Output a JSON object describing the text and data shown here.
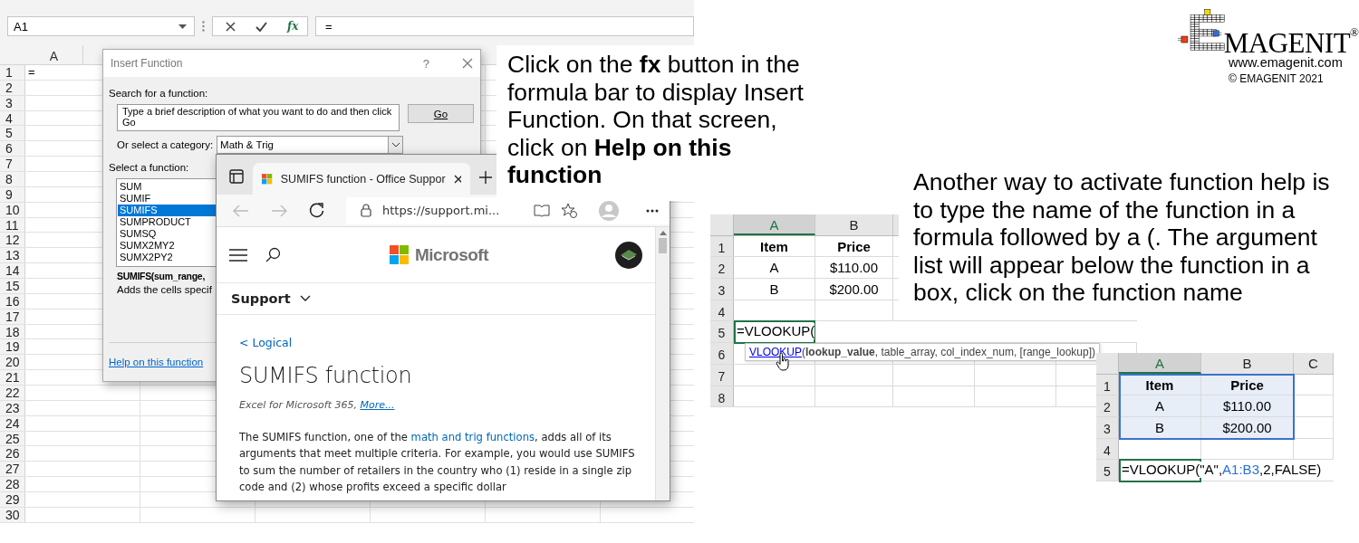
{
  "excel": {
    "name_box": "A1",
    "fx_button": "fx",
    "formula": "=",
    "column_header": "A",
    "row_numbers": [
      "1",
      "2",
      "3",
      "4",
      "5",
      "6",
      "7",
      "8",
      "9",
      "10",
      "11",
      "12",
      "13",
      "14",
      "15",
      "16",
      "17",
      "18",
      "19",
      "20",
      "21",
      "22",
      "23",
      "24",
      "25",
      "26",
      "27",
      "28",
      "29",
      "30"
    ],
    "cell_a1": "="
  },
  "insert_function": {
    "title": "Insert Function",
    "help": "?",
    "search_label": "Search for a function:",
    "search_value": "Type a brief description of what you want to do and then click Go",
    "go_button": "Go",
    "category_label": "Or select a category:",
    "category": "Math & Trig",
    "function_label": "Select a function:",
    "functions": [
      {
        "label": "SUM",
        "selected": false
      },
      {
        "label": "SUMIF",
        "selected": false
      },
      {
        "label": "SUMIFS",
        "selected": true
      },
      {
        "label": "SUMPRODUCT",
        "selected": false
      },
      {
        "label": "SUMSQ",
        "selected": false
      },
      {
        "label": "SUMX2MY2",
        "selected": false
      },
      {
        "label": "SUMX2PY2",
        "selected": false
      }
    ],
    "signature": "SUMIFS(sum_range,",
    "description": "Adds the cells specif",
    "help_link": "Help on this function"
  },
  "browser": {
    "tab_title": "SUMIFS function - Office Suppor",
    "url": "https://support.mi...",
    "brand": "Microsoft",
    "nav": "Support",
    "breadcrumb": "< Logical",
    "heading": "SUMIFS function",
    "applies_to": "Excel for Microsoft 365, ",
    "more_link": "More...",
    "body_start": "The SUMIFS function, one of the ",
    "body_link": "math and trig functions",
    "body_end": ", adds all of its arguments that meet multiple criteria. For example, you would use SUMIFS to sum the number of retailers in the country who (1) reside in a single zip code and (2) whose profits exceed a specific dollar"
  },
  "callout_fx": "Click on the **fx** button in the formula bar to display Insert Function. On that screen, click on **Help on this function**",
  "logo": {
    "name": "MAGENIT",
    "registered": "®",
    "url": "www.emagenit.com",
    "copyright": "© EMAGENIT  2021"
  },
  "callout_typing": "Another way to activate function help is to type the name of the function in a formula followed by a (. The argument list will appear below the function in a box, click on the function name",
  "sheet_typing": {
    "columns": [
      {
        "label": "A",
        "active": true
      },
      {
        "label": "B",
        "active": false
      }
    ],
    "rows": [
      {
        "number": "1",
        "kind": "header",
        "cells": [
          "Item",
          "Price"
        ]
      },
      {
        "number": "2",
        "kind": "data",
        "cells": [
          "A",
          "$110.00"
        ]
      },
      {
        "number": "3",
        "kind": "data",
        "cells": [
          "B",
          "$200.00"
        ]
      },
      {
        "number": "4",
        "kind": "empty"
      },
      {
        "number": "5",
        "kind": "formula",
        "parts": [
          {
            "text": "=VLOOKUP(",
            "kind": "plain"
          }
        ]
      },
      {
        "number": "6",
        "kind": "empty"
      },
      {
        "number": "7",
        "kind": "empty"
      },
      {
        "number": "8",
        "kind": "empty"
      }
    ],
    "tooltip": {
      "function": "VLOOKUP",
      "arguments": "(**lookup_value**, table_array, col_index_num, [range_lookup])"
    }
  },
  "sheet_result": {
    "columns": [
      {
        "label": "A",
        "active": true
      },
      {
        "label": "B",
        "active": false
      },
      {
        "label": "C",
        "active": false
      }
    ],
    "range_selected": true,
    "rows": [
      {
        "number": "1",
        "kind": "header",
        "cells": [
          "Item",
          "Price"
        ]
      },
      {
        "number": "2",
        "kind": "data",
        "cells": [
          "A",
          "$110.00"
        ]
      },
      {
        "number": "3",
        "kind": "data",
        "cells": [
          "B",
          "$200.00"
        ]
      },
      {
        "number": "4",
        "kind": "empty"
      },
      {
        "number": "5",
        "kind": "formula",
        "parts": [
          {
            "text": "=VLOOKUP(\"A\",",
            "kind": "plain"
          },
          {
            "text": "A1:B3",
            "kind": "reference"
          },
          {
            "text": ",2,FALSE)",
            "kind": "plain"
          }
        ]
      }
    ]
  }
}
